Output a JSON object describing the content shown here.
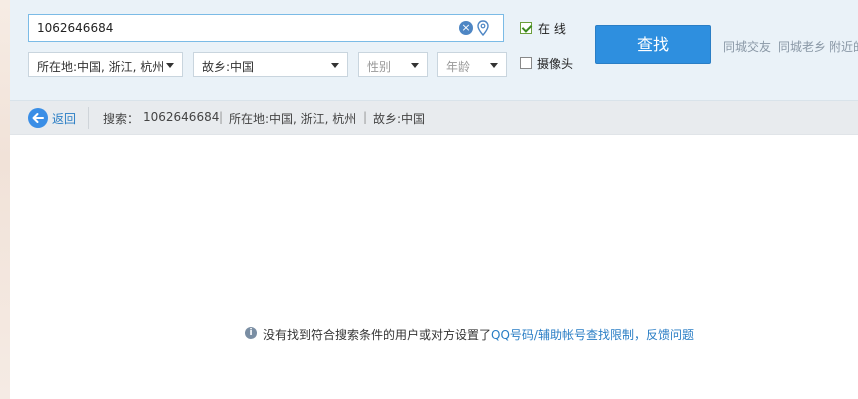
{
  "search": {
    "query": "1062646684"
  },
  "filters": {
    "location": "所在地:中国, 浙江, 杭州",
    "hometown": "故乡:中国",
    "gender_placeholder": "性别",
    "age_placeholder": "年龄"
  },
  "options": {
    "online_label": "在  线",
    "online_checked": true,
    "camera_label": "摄像头",
    "camera_checked": false
  },
  "find_button": "查找",
  "quick_links": [
    "同城交友",
    "同城老乡",
    "附近的"
  ],
  "breadcrumb": {
    "back": "返回",
    "search_prefix": "搜索：",
    "query": "1062646684",
    "location": "所在地:中国, 浙江, 杭州",
    "hometown": "故乡:中国",
    "separator": "|"
  },
  "result": {
    "message": "没有找到符合搜索条件的用户或对方设置了",
    "link1": "QQ号码/辅助帐号查找限制",
    "comma": "，",
    "link2": "反馈问题"
  },
  "colors": {
    "accent": "#2e8fdf",
    "link": "#2a7ec5"
  }
}
